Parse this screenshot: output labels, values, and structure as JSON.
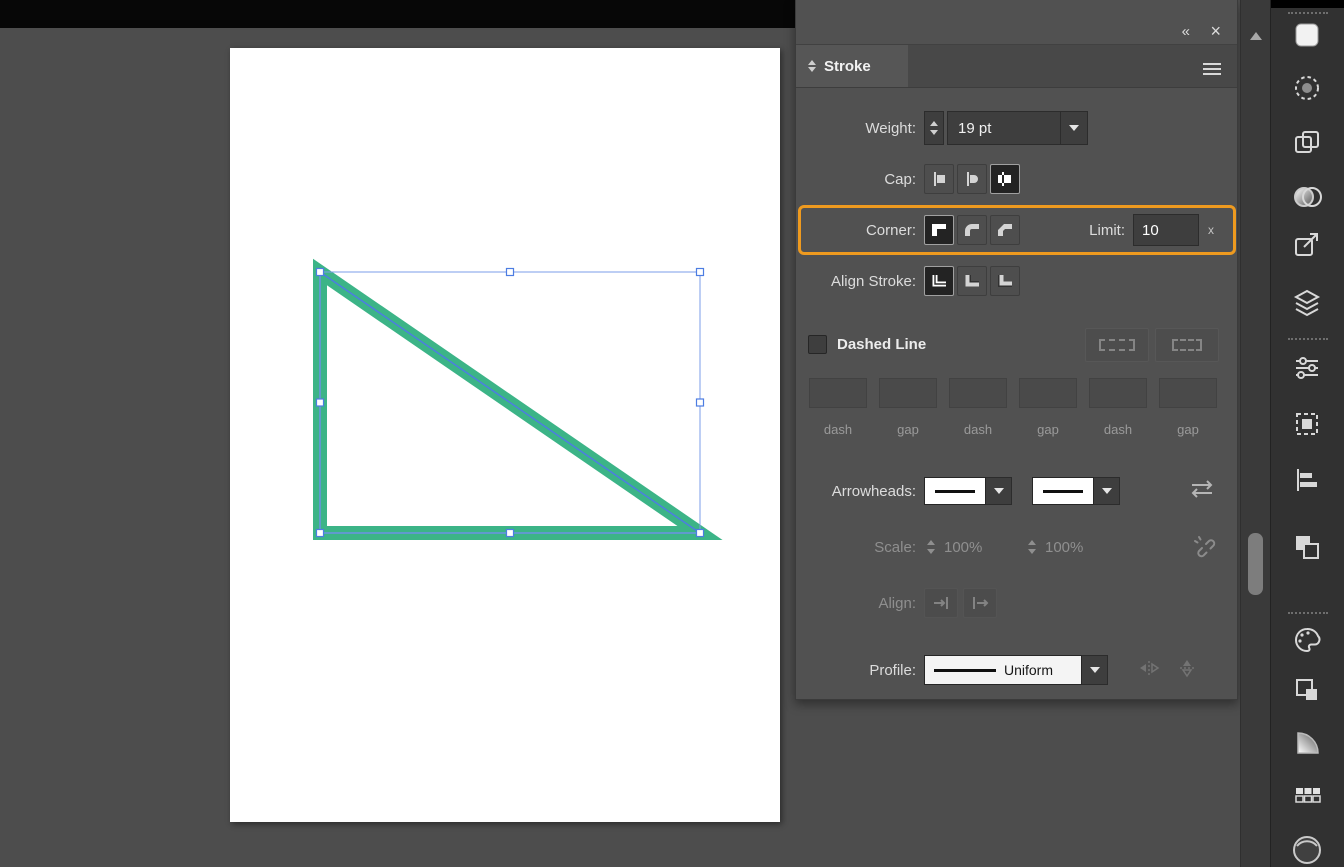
{
  "colors": {
    "highlight_orange": "#EE9A1F",
    "shape_stroke_green": "#3CB487",
    "selection_blue": "#4D7DE2",
    "panel_bg": "#515151",
    "canvas_bg": "#4D4D4D"
  },
  "panel": {
    "title": "Stroke",
    "header": {
      "collapse": "«",
      "close": "×"
    },
    "weight": {
      "label": "Weight:",
      "value": "19 pt"
    },
    "cap": {
      "label": "Cap:",
      "options": [
        "butt-cap",
        "round-cap",
        "projecting-cap"
      ],
      "selected": "projecting-cap"
    },
    "corner": {
      "label": "Corner:",
      "options": [
        "miter-join",
        "round-join",
        "bevel-join"
      ],
      "selected": "miter-join",
      "limit_label": "Limit:",
      "limit_value": "10",
      "limit_suffix": "x"
    },
    "align_stroke": {
      "label": "Align Stroke:",
      "options": [
        "align-center",
        "align-inside",
        "align-outside"
      ],
      "selected": "align-center"
    },
    "dashed": {
      "label": "Dashed Line",
      "checked": false
    },
    "dash_fields": [
      "dash",
      "gap",
      "dash",
      "gap",
      "dash",
      "gap"
    ],
    "arrowheads": {
      "label": "Arrowheads:"
    },
    "scale": {
      "label": "Scale:",
      "values": [
        "100%",
        "100%"
      ]
    },
    "align": {
      "label": "Align:"
    },
    "profile": {
      "label": "Profile:",
      "value": "Uniform"
    }
  },
  "right_toolbar": {
    "items": [
      "gradient-swatch",
      "dashed-circle",
      "copy-squares",
      "transparency",
      "export",
      "layers",
      "sliders",
      "artboard",
      "align-panel",
      "pathfinder",
      "color-palette",
      "symbols",
      "gradient-fan",
      "swatch-grid",
      "sphere"
    ]
  }
}
